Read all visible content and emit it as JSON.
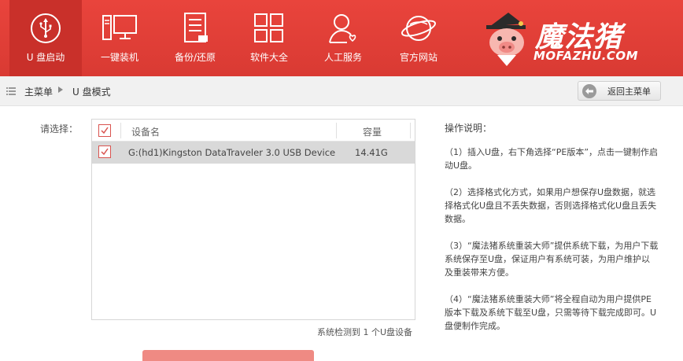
{
  "nav": {
    "items": [
      {
        "label": "U 盘启动",
        "icon": "usb-icon",
        "active": true
      },
      {
        "label": "一键装机",
        "icon": "monitor-icon",
        "active": false
      },
      {
        "label": "备份/还原",
        "icon": "document-icon",
        "active": false
      },
      {
        "label": "软件大全",
        "icon": "apps-grid-icon",
        "active": false
      },
      {
        "label": "人工服务",
        "icon": "support-person-icon",
        "active": false
      },
      {
        "label": "官方网站",
        "icon": "globe-icon",
        "active": false
      }
    ],
    "brand": {
      "title": "魔法猪",
      "subtitle": "MOFAZHU.COM",
      "mascot": "pig-mascot-icon"
    },
    "colors": {
      "bar": "#e9443c",
      "active": "#c9302a"
    }
  },
  "breadcrumb": {
    "home": "主菜单",
    "current": "U 盘模式",
    "back_label": "返回主菜单"
  },
  "device_select": {
    "label": "请选择：",
    "columns": {
      "name": "设备名",
      "size": "容量"
    },
    "rows": [
      {
        "checked": true,
        "name": "G:(hd1)Kingston DataTraveler 3.0 USB Device",
        "size": "14.41G"
      }
    ],
    "status": "系统检测到 1 个U盘设备"
  },
  "instructions": {
    "title": "操作说明：",
    "paragraphs": [
      "（1）插入U盘，右下角选择“PE版本”，点击一键制作启动U盘。",
      "（2）选择格式化方式，如果用户想保存U盘数据，就选择格式化U盘且不丢失数据，否则选择格式化U盘且丢失数据。",
      "（3）“魔法猪系统重装大师”提供系统下载，为用户下载系统保存至U盘，保证用户有系统可装，为用户维护以及重装带来方便。",
      "（4）“魔法猪系统重装大师”将全程自动为用户提供PE版本下载及系统下载至U盘，只需等待下载完成即可。U盘便制作完成。"
    ]
  }
}
